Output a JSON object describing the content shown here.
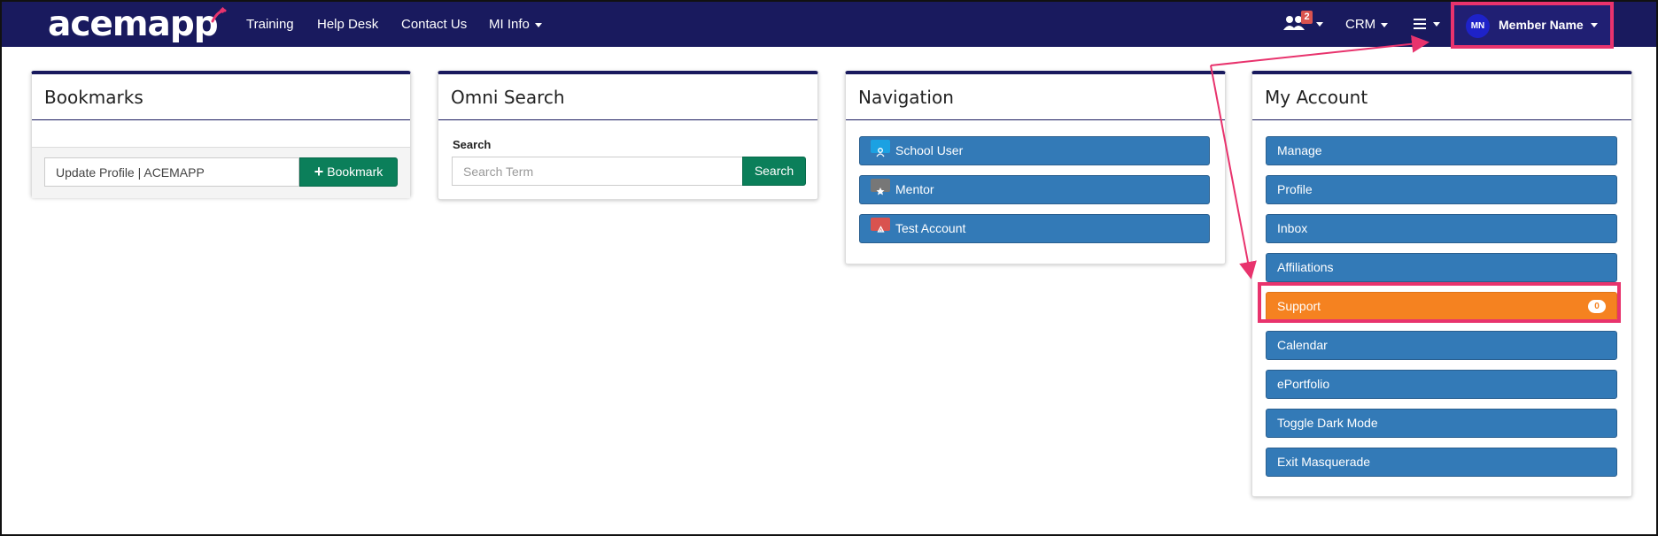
{
  "navbar": {
    "logo_text": "acemapp",
    "links": [
      "Training",
      "Help Desk",
      "Contact Us",
      "MI Info"
    ],
    "users_badge_count": "2",
    "crm_label": "CRM",
    "avatar_initials": "MN",
    "member_name": "Member Name"
  },
  "bookmarks": {
    "title": "Bookmarks",
    "input_value": "Update Profile | ACEMAPP",
    "button_label": "Bookmark"
  },
  "omni_search": {
    "title": "Omni Search",
    "label": "Search",
    "placeholder": "Search Term",
    "button_label": "Search"
  },
  "navigation": {
    "title": "Navigation",
    "items": [
      {
        "label": "School User",
        "icon": "person-icon",
        "icon_color": "#1ba1e2"
      },
      {
        "label": "Mentor",
        "icon": "badge-icon",
        "icon_color": "#777777"
      },
      {
        "label": "Test Account",
        "icon": "recycle-icon",
        "icon_color": "#d9534f"
      }
    ]
  },
  "my_account": {
    "title": "My Account",
    "items": [
      "Manage",
      "Profile",
      "Inbox",
      "Affiliations",
      "Support",
      "Calendar",
      "ePortfolio",
      "Toggle Dark Mode",
      "Exit Masquerade"
    ],
    "support_badge": "0"
  },
  "colors": {
    "navbar_bg": "#191a5e",
    "primary_blue": "#337ab7",
    "green": "#0b7f5a",
    "orange": "#f58220",
    "highlight_pink": "#e8336d"
  }
}
